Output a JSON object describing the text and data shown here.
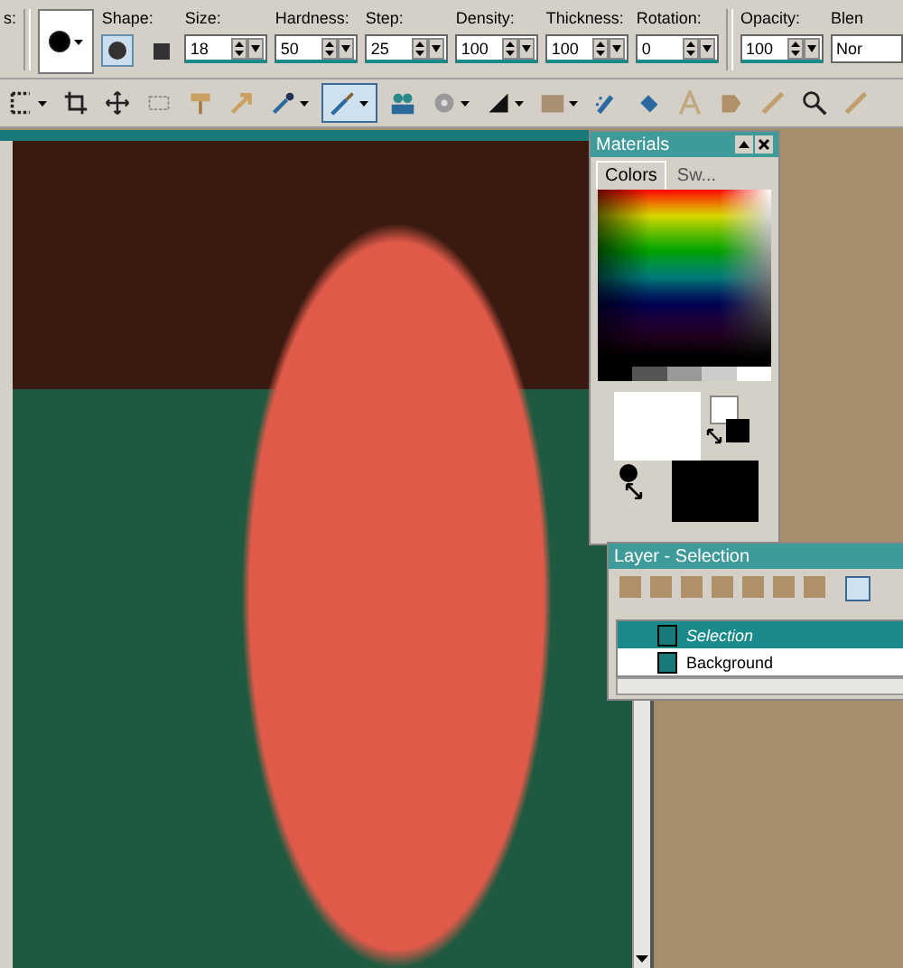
{
  "options_bar": {
    "cut_label": "s:",
    "shape": {
      "label": "Shape:",
      "options": [
        {
          "kind": "round",
          "selected": true
        },
        {
          "kind": "square",
          "selected": false
        }
      ]
    },
    "spinners": [
      {
        "label": "Size:",
        "value": "18"
      },
      {
        "label": "Hardness:",
        "value": "50"
      },
      {
        "label": "Step:",
        "value": "25"
      },
      {
        "label": "Density:",
        "value": "100"
      },
      {
        "label": "Thickness:",
        "value": "100"
      },
      {
        "label": "Rotation:",
        "value": "0"
      }
    ],
    "opacity": {
      "label": "Opacity:",
      "value": "100"
    },
    "blend": {
      "label": "Blen",
      "value": "Nor"
    }
  },
  "tools": [
    {
      "kind": "select",
      "selected": false,
      "dropdown": true
    },
    {
      "kind": "crop",
      "selected": false,
      "dropdown": false
    },
    {
      "kind": "move",
      "selected": false,
      "dropdown": false
    },
    {
      "kind": "marquee",
      "selected": false,
      "dropdown": false
    },
    {
      "kind": "roller",
      "selected": false,
      "dropdown": false
    },
    {
      "kind": "arrow",
      "selected": false,
      "dropdown": false
    },
    {
      "kind": "dropper",
      "selected": false,
      "dropdown": true
    },
    {
      "kind": "brush",
      "selected": true,
      "dropdown": true
    },
    {
      "kind": "clone",
      "selected": false,
      "dropdown": false
    },
    {
      "kind": "circle",
      "selected": false,
      "dropdown": true
    },
    {
      "kind": "contrast",
      "selected": false,
      "dropdown": true
    },
    {
      "kind": "fill",
      "selected": false,
      "dropdown": true
    },
    {
      "kind": "spray",
      "selected": false,
      "dropdown": false
    },
    {
      "kind": "bucket",
      "selected": false,
      "dropdown": false
    },
    {
      "kind": "text",
      "selected": false,
      "dropdown": false
    },
    {
      "kind": "shape",
      "selected": false,
      "dropdown": false
    },
    {
      "kind": "pen",
      "selected": false,
      "dropdown": false
    },
    {
      "kind": "zoom",
      "selected": false,
      "dropdown": false
    },
    {
      "kind": "pen",
      "selected": false,
      "dropdown": false
    }
  ],
  "materials": {
    "title": "Materials",
    "tabs": [
      {
        "label": "Colors",
        "selected": true
      },
      {
        "label": "Sw...",
        "selected": false
      }
    ]
  },
  "layers": {
    "title": "Layer - Selection",
    "items": [
      {
        "name": "Selection",
        "selected": true
      },
      {
        "name": "Background",
        "selected": false
      }
    ]
  }
}
